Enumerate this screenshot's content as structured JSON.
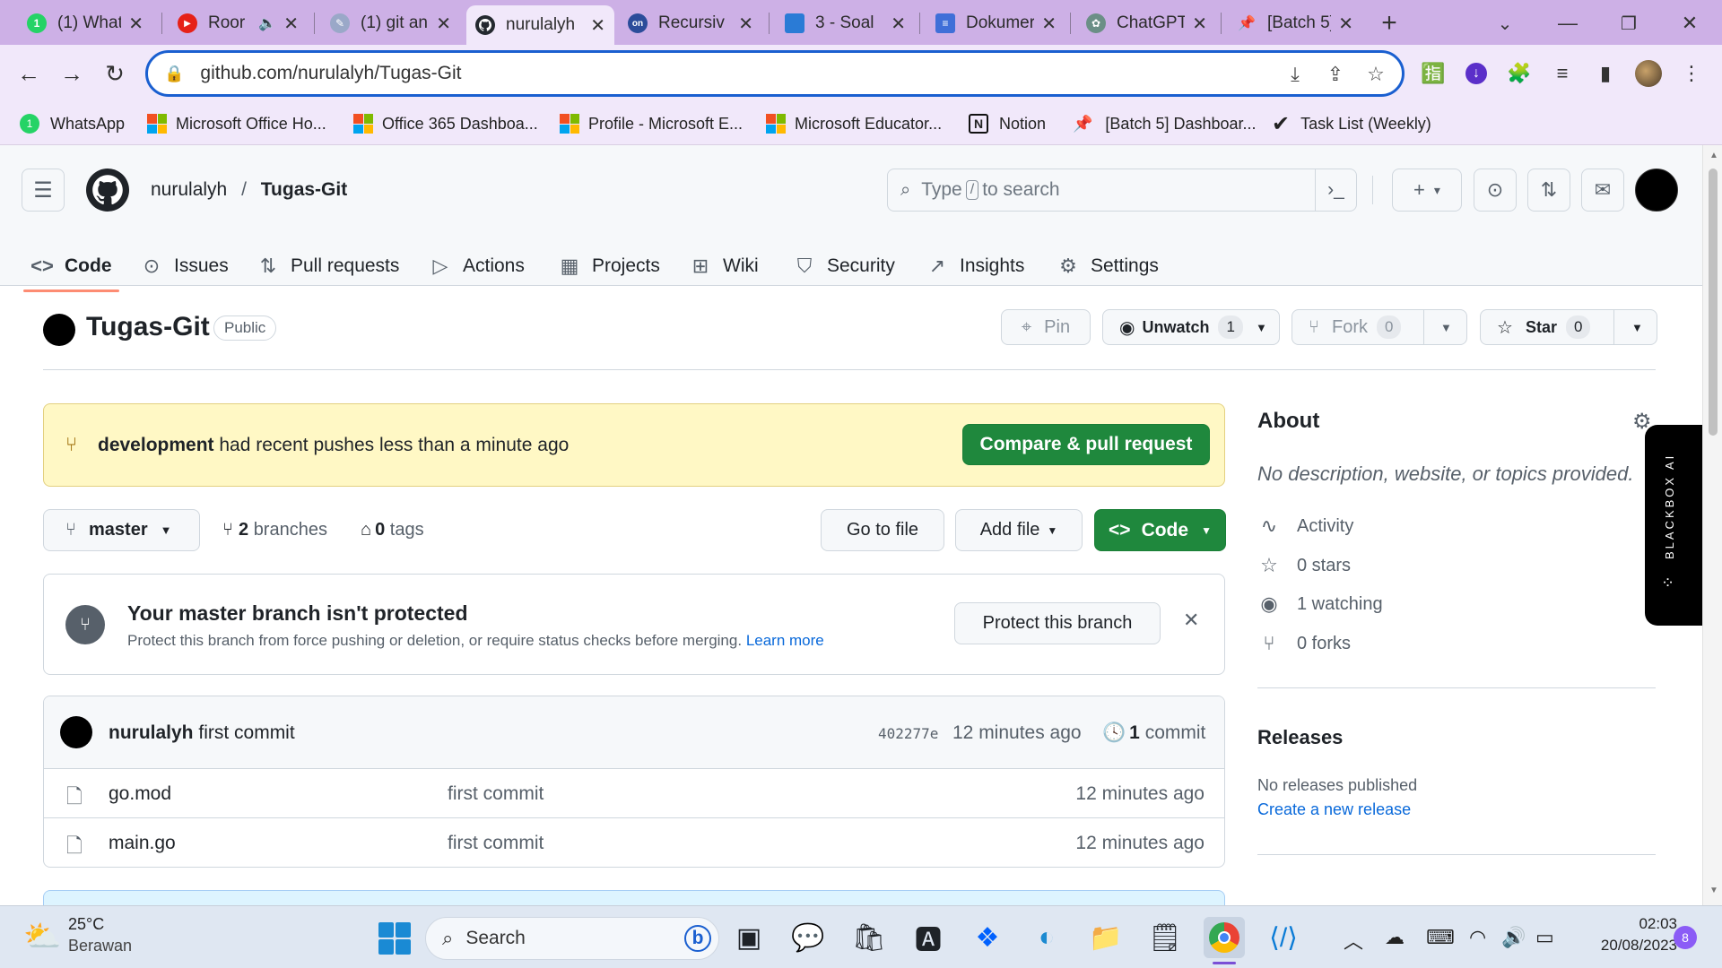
{
  "browser": {
    "tabs": [
      {
        "title": "(1) What",
        "fav_color": "#25d366",
        "fav_text": "1"
      },
      {
        "title": "Roor",
        "fav_color": "#e62117",
        "fav_text": "▶"
      },
      {
        "title": "(1) git an",
        "fav_color": "#9aa8c8",
        "fav_text": "✎"
      },
      {
        "title": "nurulalyh",
        "fav_color": "#24292f",
        "fav_text": ""
      },
      {
        "title": "Recursiv",
        "fav_color": "#2b4c9a",
        "fav_text": "on"
      },
      {
        "title": "3 - Soal",
        "fav_color": "#2a7bd6",
        "fav_text": ""
      },
      {
        "title": "Dokumer",
        "fav_color": "#3f6fd8",
        "fav_text": "≡"
      },
      {
        "title": "ChatGPT",
        "fav_color": "#6b8f86",
        "fav_text": "✿"
      },
      {
        "title": "[Batch 5]",
        "fav_color": "#e8384f",
        "fav_text": "📌"
      }
    ],
    "url": "github.com/nurulalyh/Tugas-Git",
    "bookmarks": [
      {
        "label": "WhatsApp"
      },
      {
        "label": "Microsoft Office Ho..."
      },
      {
        "label": "Office 365 Dashboa..."
      },
      {
        "label": "Profile - Microsoft E..."
      },
      {
        "label": "Microsoft Educator..."
      },
      {
        "label": "Notion"
      },
      {
        "label": "[Batch 5] Dashboar..."
      },
      {
        "label": "Task List (Weekly)"
      }
    ]
  },
  "github": {
    "owner": "nurulalyh",
    "slash": "/",
    "repo": "Tugas-Git",
    "search_placeholder_pre": "Type",
    "search_key": "/",
    "search_placeholder_post": "to search",
    "nav_tabs": [
      {
        "label": "Code",
        "icon": "<>"
      },
      {
        "label": "Issues",
        "icon": "⊙"
      },
      {
        "label": "Pull requests",
        "icon": "⇅"
      },
      {
        "label": "Actions",
        "icon": "▷"
      },
      {
        "label": "Projects",
        "icon": "▦"
      },
      {
        "label": "Wiki",
        "icon": "📖"
      },
      {
        "label": "Security",
        "icon": "🛡"
      },
      {
        "label": "Insights",
        "icon": "📈"
      },
      {
        "label": "Settings",
        "icon": "⚙"
      }
    ],
    "repo_title": "Tugas-Git",
    "visibility": "Public",
    "pin_label": "Pin",
    "unwatch_label": "Unwatch",
    "unwatch_count": "1",
    "fork_label": "Fork",
    "fork_count": "0",
    "star_label": "Star",
    "star_count": "0",
    "push_banner": {
      "branch": "development",
      "text": "had recent pushes less than a minute ago",
      "button": "Compare & pull request"
    },
    "branch_button": "master",
    "branches_count": "2",
    "branches_label": "branches",
    "tags_count": "0",
    "tags_label": "tags",
    "go_to_file": "Go to file",
    "add_file": "Add file",
    "code_button": "Code",
    "protect": {
      "title": "Your master branch isn't protected",
      "desc": "Protect this branch from force pushing or deletion, or require status checks before merging.",
      "learn_more": "Learn more",
      "button": "Protect this branch"
    },
    "latest_commit": {
      "author": "nurulalyh",
      "message": "first commit",
      "sha": "402277e",
      "time": "12 minutes ago",
      "commits_count": "1",
      "commits_label": "commit"
    },
    "files": [
      {
        "name": "go.mod",
        "message": "first commit",
        "time": "12 minutes ago"
      },
      {
        "name": "main.go",
        "message": "first commit",
        "time": "12 minutes ago"
      }
    ],
    "about": {
      "heading": "About",
      "description": "No description, website, or topics provided.",
      "activity": "Activity",
      "stars": "0 stars",
      "watching": "1 watching",
      "forks": "0 forks"
    },
    "releases": {
      "heading": "Releases",
      "none": "No releases published",
      "create": "Create a new release"
    },
    "blackbox_label": "BLACKBOX AI"
  },
  "taskbar": {
    "temp": "25°C",
    "weather": "Berawan",
    "search": "Search",
    "time": "02:03",
    "date": "20/08/2023",
    "notifications": "8"
  }
}
